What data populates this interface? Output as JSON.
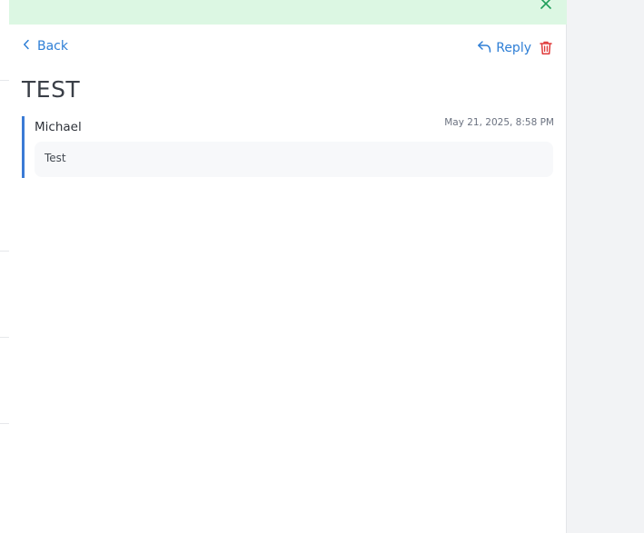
{
  "banner": {
    "close_icon": "close-icon",
    "color": "#dcf7e3"
  },
  "nav": {
    "back_label": "Back"
  },
  "actions": {
    "reply_label": "Reply",
    "reply_icon": "reply-icon",
    "delete_icon": "trash-icon"
  },
  "thread": {
    "title": "TEST",
    "messages": [
      {
        "sender": "Michael",
        "timestamp": "May 21, 2025, 8:58 PM",
        "body": "Test"
      }
    ]
  },
  "colors": {
    "accent": "#2f7fd6",
    "danger": "#e03b3b",
    "quote_bar": "#3b7bd5"
  }
}
